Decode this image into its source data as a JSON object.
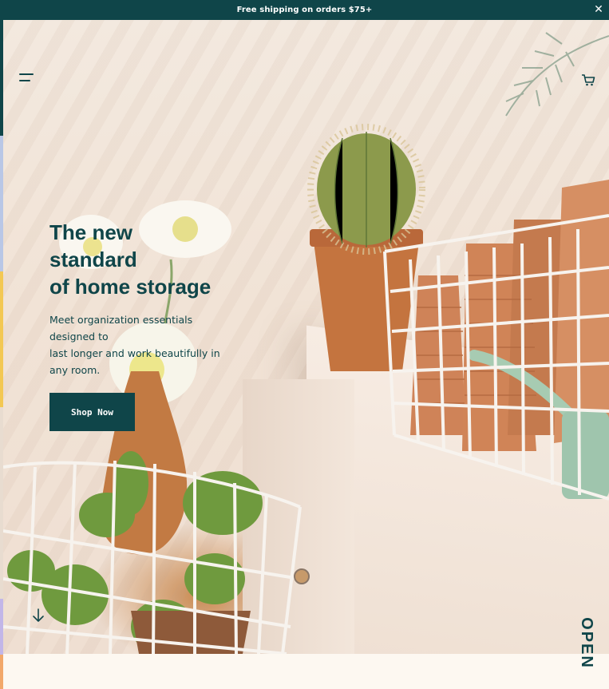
{
  "announcement": {
    "text": "Free shipping on orders $75+",
    "close_icon": "close-icon"
  },
  "header": {
    "menu_icon": "menu-icon",
    "cart_icon": "cart-icon"
  },
  "hero": {
    "headline_lines": [
      "The new",
      "standard",
      "of home storage"
    ],
    "subcopy_lines": [
      "Meet organization essentials",
      "designed to",
      "last longer and work beautifully in",
      "any room."
    ],
    "cta_label": "Shop Now",
    "scroll_icon": "arrow-down-icon"
  },
  "side_tab": {
    "label": "OPEN"
  },
  "colors": {
    "brand": "#0f4549",
    "background": "#fdf8f1",
    "accent_strip": [
      "#0f4549",
      "#b9c7e6",
      "#f3c853",
      "#c2b6e8",
      "#f2a86a"
    ]
  }
}
